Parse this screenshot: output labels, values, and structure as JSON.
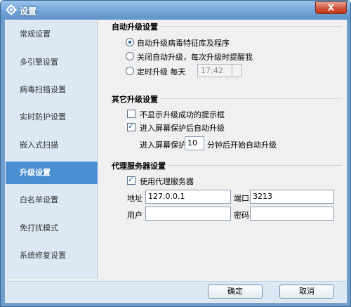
{
  "window": {
    "title": "设置",
    "close_label": "X"
  },
  "sidebar": {
    "items": [
      {
        "label": "常规设置"
      },
      {
        "label": "多引擎设置"
      },
      {
        "label": "病毒扫描设置"
      },
      {
        "label": "实时防护设置"
      },
      {
        "label": "嵌入式扫描"
      },
      {
        "label": "升级设置"
      },
      {
        "label": "白名单设置"
      },
      {
        "label": "免打扰模式"
      },
      {
        "label": "系统修复设置"
      }
    ],
    "active_index": 5
  },
  "auto_upgrade": {
    "title": "自动升级设置",
    "opt1": "自动升级病毒特征库及程序",
    "opt2": "关闭自动升级，每次升级时提醒我",
    "opt3": "定时升级  每天",
    "time_value": "17:42"
  },
  "other_upgrade": {
    "title": "其它升级设置",
    "check1": "不显示升级成功的提示框",
    "check2": "进入屏幕保护后自动升级",
    "screen_prefix": "进入屏幕保护",
    "screen_minutes": "10",
    "screen_suffix": "分钟后开始自动升级"
  },
  "proxy": {
    "title": "代理服务器设置",
    "use_proxy": "使用代理服务器",
    "address_label": "地址",
    "address_value": "127.0.0.1",
    "port_label": "端口",
    "port_value": "3213",
    "user_label": "用户",
    "user_value": "",
    "password_label": "密码",
    "password_value": ""
  },
  "buttons": {
    "ok": "确定",
    "cancel": "取消"
  }
}
